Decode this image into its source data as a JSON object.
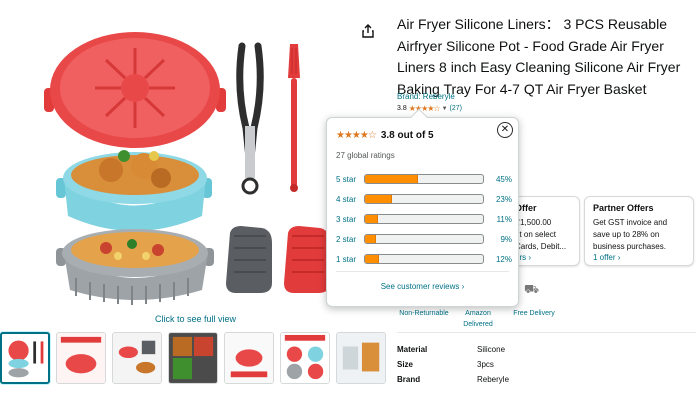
{
  "product": {
    "title": "Air Fryer Silicone Liners： 3 PCS Reusable Airfryer Silicone Pot - Food Grade Air Fryer Liners 8 inch Easy Cleaning Silicone Air Fryer Baking Tray For 4-7 QT Air Fryer Basket",
    "brand_label": "Brand: Reberyle",
    "rating_value": "3.8",
    "rating_count": "(27)"
  },
  "gallery": {
    "click_full_view": "Click to see full view"
  },
  "popover": {
    "score_text": "3.8 out of 5",
    "global_ratings": "27 global ratings",
    "histogram": [
      {
        "label": "5 star",
        "pct_text": "45%",
        "pct": 45
      },
      {
        "label": "4 star",
        "pct_text": "23%",
        "pct": 23
      },
      {
        "label": "3 star",
        "pct_text": "11%",
        "pct": 11
      },
      {
        "label": "2 star",
        "pct_text": "9%",
        "pct": 9
      },
      {
        "label": "1 star",
        "pct_text": "12%",
        "pct": 12
      }
    ],
    "see_reviews": "See customer reviews ›",
    "close_glyph": "✕"
  },
  "offers": {
    "bank": {
      "title": "Offer",
      "line1": "₹1,500.00",
      "line2": "nt on select",
      "line3": "Cards, Debit...",
      "link": "ers ›"
    },
    "partner": {
      "title": "Partner Offers",
      "line1": "Get GST invoice and",
      "line2": "save up to 28% on",
      "line3": "business purchases.",
      "link": "1 offer ›"
    }
  },
  "delivery": {
    "non_returnable": "Non-Returnable",
    "amazon_delivered": "Amazon Delivered",
    "free_delivery": "Free Delivery"
  },
  "specs": [
    {
      "key": "Material",
      "value": "Silicone"
    },
    {
      "key": "Size",
      "value": "3pcs"
    },
    {
      "key": "Brand",
      "value": "Reberyle"
    }
  ],
  "colors": {
    "star": "#de7921",
    "bar_fill": "#ff8f00",
    "link": "#007185"
  }
}
